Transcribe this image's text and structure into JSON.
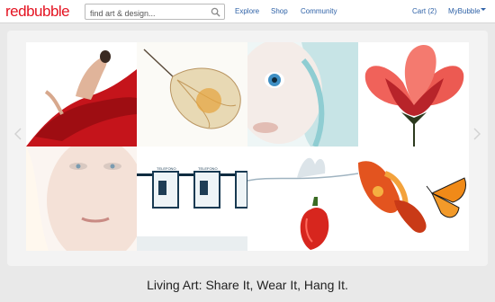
{
  "header": {
    "logo": {
      "prefix": "red",
      "suffix": "bubble"
    },
    "search": {
      "placeholder": "find art & design...",
      "value": ""
    },
    "nav": {
      "explore": "Explore",
      "shop": "Shop",
      "community": "Community"
    },
    "account": {
      "cart": "Cart (2)",
      "mybubble": "MyBubble"
    }
  },
  "hero": {
    "images": [
      {
        "name": "dancer-red-dress"
      },
      {
        "name": "physalis-husk"
      },
      {
        "name": "baby-portrait"
      },
      {
        "name": "red-poppy-flower"
      },
      {
        "name": "woman-face-portrait"
      },
      {
        "name": "telephone-booths"
      },
      {
        "name": "pepper-water-splash"
      },
      {
        "name": "butterfly-on-flower"
      }
    ],
    "booth_label": "TELEFONO"
  },
  "tagline": "Living Art: Share It, Wear It, Hang It.",
  "colors": {
    "brand_red": "#e41321",
    "link_blue": "#2f62a7"
  }
}
